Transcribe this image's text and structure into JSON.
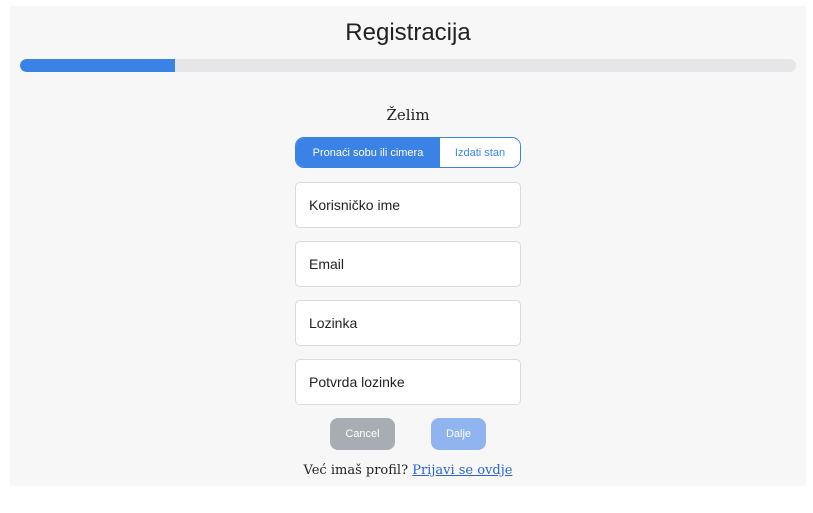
{
  "header": {
    "title": "Registracija"
  },
  "progress": {
    "value_fraction": 0.2,
    "color": "#3b82e7"
  },
  "form": {
    "want_label": "Želim",
    "toggle": {
      "options": [
        "Pronaći sobu ili cimera",
        "Izdati stan"
      ],
      "selected": "Pronaći sobu ili cimera"
    },
    "fields": {
      "username_placeholder": "Korisničko ime",
      "email_placeholder": "Email",
      "password_placeholder": "Lozinka",
      "confirm_password_placeholder": "Potvrda lozinke"
    },
    "buttons": {
      "cancel_label": "Cancel",
      "next_label": "Dalje"
    },
    "login_prompt": {
      "text": "Već imaš profil?",
      "link_text": "Prijavi se ovdje"
    }
  },
  "colors": {
    "accent": "#3b82e7",
    "cancel_button": "#a8adb3",
    "next_button": "#8fb4f0",
    "link": "#2a63d8"
  }
}
